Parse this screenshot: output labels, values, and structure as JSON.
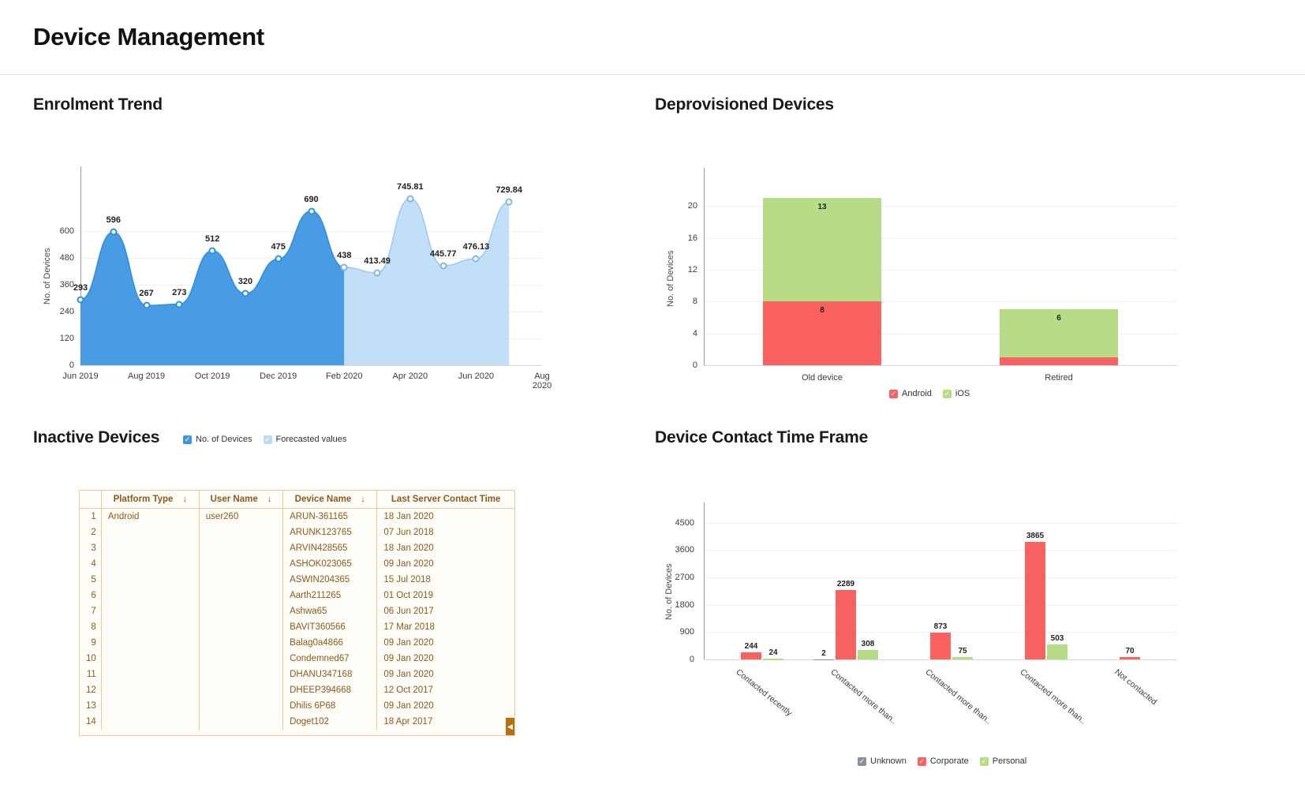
{
  "header": {
    "title": "Device Management"
  },
  "colors": {
    "actual_blue": "#3f97e3",
    "forecast_blue": "#bcdcf6",
    "android_red": "#fa6262",
    "ios_green": "#b6dd86",
    "unknown_gray": "#8a8f99",
    "table_accent": "#8a5a1e"
  },
  "panels": {
    "enrolment": {
      "title": "Enrolment Trend"
    },
    "deprovisioned": {
      "title": "Deprovisioned Devices"
    },
    "inactive": {
      "title": "Inactive Devices"
    },
    "contact": {
      "title": "Device Contact Time Frame"
    }
  },
  "chart_data": [
    {
      "id": "enrolment-trend",
      "type": "area",
      "title": "Enrolment Trend",
      "xlabel": "",
      "ylabel": "No. of Devices",
      "ylim": [
        0,
        840
      ],
      "yticks": [
        0,
        120,
        240,
        360,
        480,
        600
      ],
      "xticks": [
        "Jun 2019",
        "Aug 2019",
        "Oct 2019",
        "Dec 2019",
        "Feb 2020",
        "Apr 2020",
        "Jun 2020",
        "Aug 2020"
      ],
      "grid": true,
      "legend_position": "bottom",
      "legend": [
        {
          "label": "No. of Devices",
          "color": "#3f97e3"
        },
        {
          "label": "Forecasted values",
          "color": "#bcdcf6"
        }
      ],
      "series": [
        {
          "name": "No. of Devices",
          "color": "#3f97e3",
          "points": [
            {
              "x": "Jun 2019",
              "y": 293,
              "label": "293"
            },
            {
              "x": "Jul 2019",
              "y": 596,
              "label": "596"
            },
            {
              "x": "Aug 2019",
              "y": 267,
              "label": "267"
            },
            {
              "x": "Sep 2019",
              "y": 273,
              "label": "273"
            },
            {
              "x": "Oct 2019",
              "y": 512,
              "label": "512"
            },
            {
              "x": "Nov 2019",
              "y": 320,
              "label": "320"
            },
            {
              "x": "Dec 2019",
              "y": 475,
              "label": "475"
            },
            {
              "x": "Jan 2020",
              "y": 690,
              "label": "690"
            },
            {
              "x": "Feb 2020",
              "y": 438,
              "label": "438"
            }
          ]
        },
        {
          "name": "Forecasted values",
          "color": "#bcdcf6",
          "points": [
            {
              "x": "Feb 2020",
              "y": 438,
              "label": "438"
            },
            {
              "x": "Mar 2020",
              "y": 413.49,
              "label": "413.49"
            },
            {
              "x": "Apr 2020",
              "y": 745.81,
              "label": "745.81"
            },
            {
              "x": "May 2020",
              "y": 445.77,
              "label": "445.77"
            },
            {
              "x": "Jun 2020",
              "y": 476.13,
              "label": "476.13"
            },
            {
              "x": "Jul 2020",
              "y": 729.84,
              "label": "729.84"
            }
          ]
        }
      ]
    },
    {
      "id": "deprovisioned-devices",
      "type": "bar",
      "stacked": true,
      "title": "Deprovisioned Devices",
      "xlabel": "",
      "ylabel": "No. of Devices",
      "ylim": [
        0,
        23
      ],
      "yticks": [
        0,
        4,
        8,
        12,
        16,
        20
      ],
      "categories": [
        "Old device",
        "Retired"
      ],
      "grid": true,
      "legend_position": "bottom",
      "series": [
        {
          "name": "Android",
          "color": "#fa6262",
          "values": [
            8,
            1
          ],
          "labels": [
            "8",
            ""
          ]
        },
        {
          "name": "iOS",
          "color": "#b6dd86",
          "values": [
            13,
            6
          ],
          "labels": [
            "13",
            "6"
          ]
        }
      ]
    },
    {
      "id": "device-contact-time-frame",
      "type": "bar",
      "stacked": false,
      "title": "Device Contact Time Frame",
      "xlabel": "",
      "ylabel": "No. of Devices",
      "ylim": [
        0,
        4800
      ],
      "yticks": [
        0,
        900,
        1800,
        2700,
        3600,
        4500
      ],
      "categories": [
        "Contacted recently",
        "Contacted more than..",
        "Contacted more than..",
        "Contacted more than..",
        "Not contacted"
      ],
      "grid": true,
      "legend_position": "bottom",
      "series": [
        {
          "name": "Unknown",
          "color": "#8a8f99",
          "values": [
            0,
            2,
            0,
            0,
            0
          ],
          "labels": [
            "",
            "2",
            "",
            "",
            ""
          ]
        },
        {
          "name": "Corporate",
          "color": "#fa6262",
          "values": [
            244,
            2289,
            873,
            3865,
            70
          ],
          "labels": [
            "244",
            "2289",
            "873",
            "3865",
            "70"
          ]
        },
        {
          "name": "Personal",
          "color": "#b6dd86",
          "values": [
            24,
            308,
            75,
            503,
            0
          ],
          "labels": [
            "24",
            "308",
            "75",
            "503",
            ""
          ]
        }
      ]
    }
  ],
  "inactive_table": {
    "columns": [
      "",
      "Platform Type",
      "User Name",
      "Device Name",
      "Last Server Contact Time"
    ],
    "sortable": [
      false,
      true,
      true,
      true,
      false
    ],
    "sort_icon": "↓",
    "scroll_icon": "◀",
    "rows": [
      {
        "idx": "1",
        "platform": "Android",
        "user": "user260",
        "device": "ARUN-361165",
        "last": "18 Jan 2020"
      },
      {
        "idx": "2",
        "platform": "",
        "user": "",
        "device": "ARUNK123765",
        "last": "07 Jun 2018"
      },
      {
        "idx": "3",
        "platform": "",
        "user": "",
        "device": "ARVIN428565",
        "last": "18 Jan 2020"
      },
      {
        "idx": "4",
        "platform": "",
        "user": "",
        "device": "ASHOK023065",
        "last": "09 Jan 2020"
      },
      {
        "idx": "5",
        "platform": "",
        "user": "",
        "device": "ASWIN204365",
        "last": "15 Jul 2018"
      },
      {
        "idx": "6",
        "platform": "",
        "user": "",
        "device": "Aarth211265",
        "last": "01 Oct 2019"
      },
      {
        "idx": "7",
        "platform": "",
        "user": "",
        "device": "Ashwa65",
        "last": "06 Jun 2017"
      },
      {
        "idx": "8",
        "platform": "",
        "user": "",
        "device": "BAVIT360566",
        "last": "17 Mar 2018"
      },
      {
        "idx": "9",
        "platform": "",
        "user": "",
        "device": "Balag0a4866",
        "last": "09 Jan 2020"
      },
      {
        "idx": "10",
        "platform": "",
        "user": "",
        "device": "Condemned67",
        "last": "09 Jan 2020"
      },
      {
        "idx": "11",
        "platform": "",
        "user": "",
        "device": "DHANU347168",
        "last": "09 Jan 2020"
      },
      {
        "idx": "12",
        "platform": "",
        "user": "",
        "device": "DHEEP394668",
        "last": "12 Oct 2017"
      },
      {
        "idx": "13",
        "platform": "",
        "user": "",
        "device": "Dhilis 6P68",
        "last": "09 Jan 2020"
      },
      {
        "idx": "14",
        "platform": "",
        "user": "",
        "device": "Doget102",
        "last": "18 Apr 2017"
      }
    ]
  }
}
